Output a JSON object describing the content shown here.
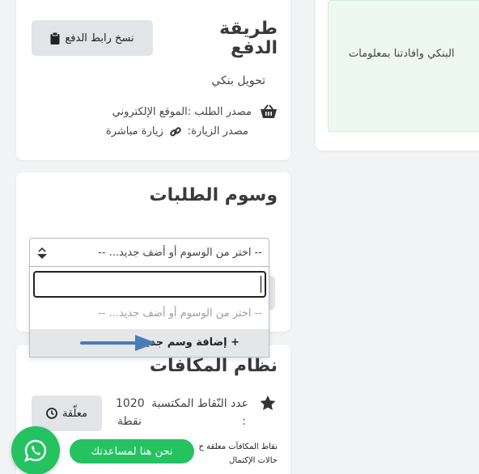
{
  "payment": {
    "title_line1": "طريقة",
    "title_line2": "الدفع",
    "copy_link_label": "نسخ رابط الدفع",
    "method": "تحويل بنكي",
    "order_source_label": "مصدر الطلب :الموقع الإلكتروني",
    "visit_source_label": "مصدر الزيارة:",
    "visit_source_value": "زيارة مباشرة"
  },
  "right_panel": {
    "notice_text": "البنكي وافادتنا بمعلومات"
  },
  "tags": {
    "title": "وسوم الطلبات",
    "select_placeholder": "-- اختر من الوسوم أو أضف جديد... --",
    "search_value": "",
    "option_placeholder": "-- اختر من الوسوم أو أضف جديد... --",
    "add_new_label": "+ إضافة وسم جديد"
  },
  "rewards": {
    "title": "نظام المكافآت",
    "points_label": "عدد النّقاط المكتسبة",
    "points_value": "1020",
    "points_unit": "نقطة",
    "colon": ":",
    "status_label": "معلّقة",
    "note_line1": "نقاط المكافآت معلقة ح",
    "note_line2": "حالات الإكتمال"
  },
  "chat": {
    "label": "نحن هنا لمساعدتك"
  },
  "colors": {
    "accent_green": "#25c262",
    "notice_bg": "#edf8f1",
    "arrow_blue": "#4a7db8"
  }
}
